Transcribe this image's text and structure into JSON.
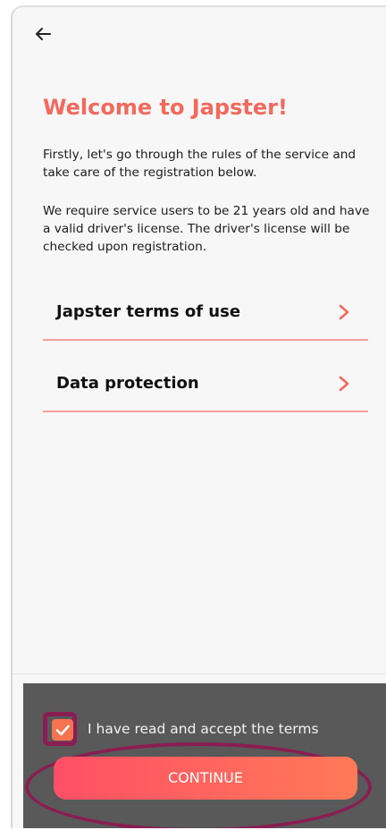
{
  "header": {
    "back_icon": "arrow-left-icon"
  },
  "welcome": {
    "title": "Welcome to Japster!",
    "intro": "Firstly, let's go through the rules of the service and take care of the registration below.",
    "requirements": "We require service users to be 21 years old and have a valid driver's license. The driver's license will be checked upon registration."
  },
  "links": [
    {
      "label": "Japster terms of use",
      "icon": "chevron-right-icon"
    },
    {
      "label": "Data protection",
      "icon": "chevron-right-icon"
    }
  ],
  "footer": {
    "accept_label": "I have read and accept the terms",
    "accept_checked": true,
    "continue_label": "CONTINUE"
  },
  "colors": {
    "accent": "#f26a5d",
    "button_start": "#ff4f66",
    "button_end": "#ff7a57",
    "footer_bg": "#595959",
    "highlight": "#8a1d52"
  }
}
